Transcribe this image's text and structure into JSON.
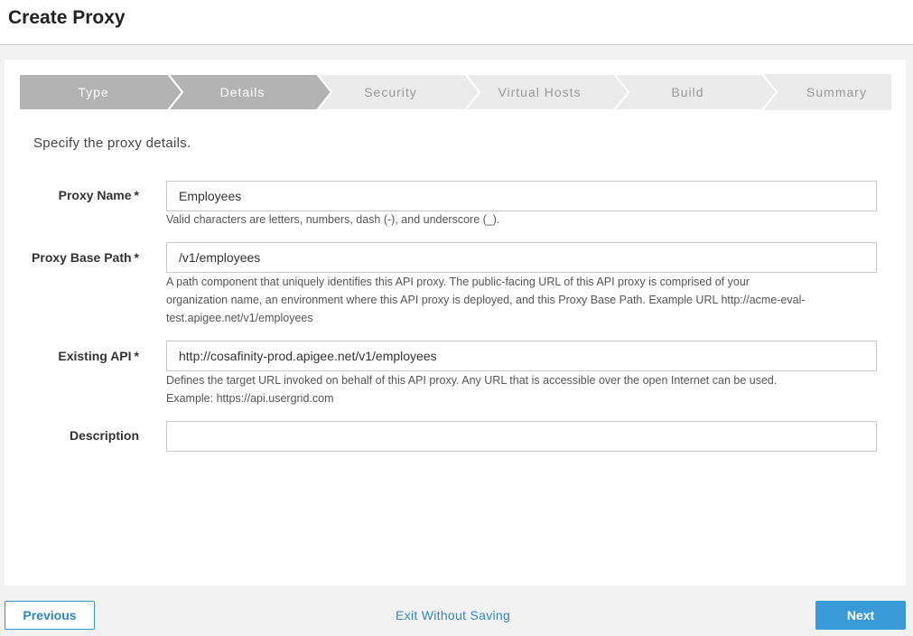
{
  "header": {
    "title": "Create Proxy"
  },
  "steps": [
    {
      "label": "Type",
      "state": "done"
    },
    {
      "label": "Details",
      "state": "done"
    },
    {
      "label": "Security",
      "state": "todo"
    },
    {
      "label": "Virtual Hosts",
      "state": "todo"
    },
    {
      "label": "Build",
      "state": "todo"
    },
    {
      "label": "Summary",
      "state": "todo"
    }
  ],
  "colors": {
    "step_done": "#b3b3b3",
    "step_todo": "#ebebeb",
    "accent": "#3a9ad8"
  },
  "form": {
    "intro": "Specify the proxy details.",
    "required_marker": "*",
    "proxy_name": {
      "label": "Proxy Name",
      "value": "Employees",
      "help": "Valid characters are letters, numbers, dash (-), and underscore (_)."
    },
    "base_path": {
      "label": "Proxy Base Path",
      "value": "/v1/employees",
      "help_line1": "A path component that uniquely identifies this API proxy. The public-facing URL of this API proxy is comprised of your",
      "help_line2": "organization name, an environment where this API proxy is deployed, and this Proxy Base Path. Example URL http://acme-eval-",
      "help_line3": "test.apigee.net/v1/employees"
    },
    "existing_api": {
      "label": "Existing API",
      "value": "http://cosafinity-prod.apigee.net/v1/employees",
      "help_line1": "Defines the target URL invoked on behalf of this API proxy. Any URL that is accessible over the open Internet can be used.",
      "help_line2": "Example: https://api.usergrid.com"
    },
    "description": {
      "label": "Description",
      "value": ""
    }
  },
  "footer": {
    "previous": "Previous",
    "exit": "Exit Without Saving",
    "next": "Next"
  }
}
